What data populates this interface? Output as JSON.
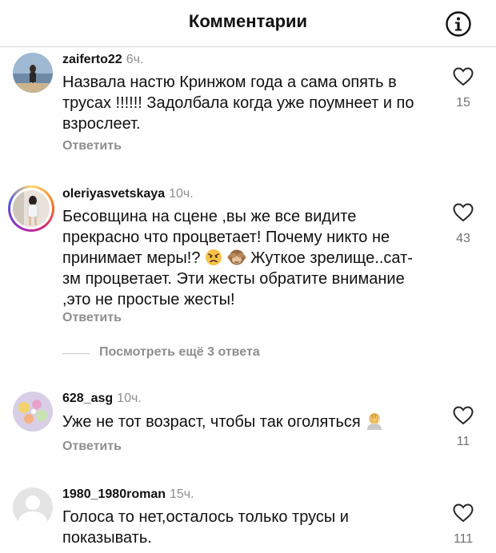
{
  "header": {
    "title": "Комментарии",
    "info_icon": "info-circle-icon"
  },
  "comments": [
    {
      "username": "zaiferto22",
      "time": "6ч.",
      "text": "Назвала настю Кринжом года а сама опять в трусах !!!!!! Задолбала когда уже поумнеет и по взрослеет.",
      "reply_label": "Ответить",
      "likes": "15"
    },
    {
      "username": "oleriyasvetskaya",
      "time": "10ч.",
      "text_part1": "Бесовщина на сцене ,вы же все видите прекрасно что процветает! Почему никто не принимает меры!?",
      "text_part2": "Жуткое зрелище..сат-зм процветает. Эти жесты обратите внимание ,это не простые жесты!",
      "emojis": [
        "angry-face-emoji",
        "see-no-evil-monkey-emoji"
      ],
      "reply_label": "Ответить",
      "likes": "43",
      "has_story": true
    },
    {
      "username": "628_asg",
      "time": "10ч.",
      "text": "Уже не тот возраст, чтобы так оголяться",
      "emojis": [
        "facepalm-emoji"
      ],
      "reply_label": "Ответить",
      "likes": "11"
    },
    {
      "username": "1980_1980roman",
      "time": "15ч.",
      "text": "Голоса то нет,осталось только трусы и показывать.",
      "likes": "111",
      "avatar": "default-avatar"
    }
  ],
  "more_replies": {
    "label": "Посмотреть ещё 3 ответа"
  },
  "colors": {
    "secondary_text": "#8e8e8e",
    "divider": "#dbdbdb",
    "text": "#111111"
  }
}
